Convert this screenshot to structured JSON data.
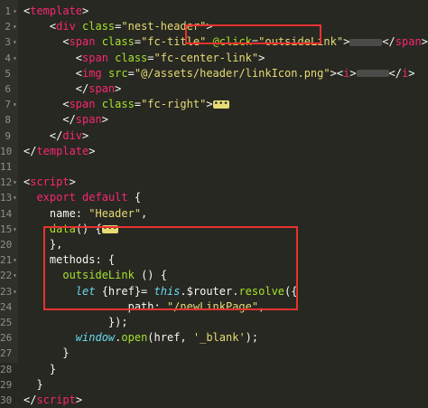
{
  "editor": {
    "lines": [
      {
        "n": "1",
        "segs": [
          {
            "c": "pl",
            "t": "<"
          },
          {
            "c": "tag",
            "t": "template"
          },
          {
            "c": "pl",
            "t": ">"
          }
        ]
      },
      {
        "n": "2",
        "segs": [
          {
            "c": "pl",
            "t": "    <"
          },
          {
            "c": "tag",
            "t": "div"
          },
          {
            "c": "attr",
            "t": " class"
          },
          {
            "c": "pl",
            "t": "="
          },
          {
            "c": "str",
            "t": "\"nest-header\""
          },
          {
            "c": "pl",
            "t": ">"
          }
        ]
      },
      {
        "n": "3",
        "segs": [
          {
            "c": "pl",
            "t": "      <"
          },
          {
            "c": "tag",
            "t": "span"
          },
          {
            "c": "attr",
            "t": " class"
          },
          {
            "c": "pl",
            "t": "="
          },
          {
            "c": "str",
            "t": "\"fc-title\""
          },
          {
            "c": "pl",
            "t": " "
          },
          {
            "c": "attr",
            "t": "@click"
          },
          {
            "c": "pl",
            "t": "="
          },
          {
            "c": "str",
            "t": "\"outsideLink\""
          },
          {
            "c": "pl",
            "t": ">"
          },
          {
            "c": "blur",
            "t": ""
          },
          {
            "c": "pl",
            "t": "</"
          },
          {
            "c": "tag",
            "t": "span"
          },
          {
            "c": "pl",
            "t": ">"
          }
        ]
      },
      {
        "n": "4",
        "segs": [
          {
            "c": "pl",
            "t": "        <"
          },
          {
            "c": "tag",
            "t": "span"
          },
          {
            "c": "attr",
            "t": " class"
          },
          {
            "c": "pl",
            "t": "="
          },
          {
            "c": "str",
            "t": "\"fc-center-link\""
          },
          {
            "c": "pl",
            "t": ">"
          }
        ]
      },
      {
        "n": "5",
        "segs": [
          {
            "c": "pl",
            "t": "        <"
          },
          {
            "c": "tag",
            "t": "img"
          },
          {
            "c": "attr",
            "t": " src"
          },
          {
            "c": "pl",
            "t": "="
          },
          {
            "c": "str",
            "t": "\"@/assets/header/linkIcon.png\""
          },
          {
            "c": "pl",
            "t": ">"
          },
          {
            "c": "pl",
            "t": "<"
          },
          {
            "c": "tag",
            "t": "i"
          },
          {
            "c": "pl",
            "t": ">"
          },
          {
            "c": "blur",
            "t": ""
          },
          {
            "c": "pl",
            "t": "</"
          },
          {
            "c": "tag",
            "t": "i"
          },
          {
            "c": "pl",
            "t": ">"
          }
        ]
      },
      {
        "n": "6",
        "segs": [
          {
            "c": "pl",
            "t": "        </"
          },
          {
            "c": "tag",
            "t": "span"
          },
          {
            "c": "pl",
            "t": ">"
          }
        ]
      },
      {
        "n": "7",
        "segs": [
          {
            "c": "pl",
            "t": "      <"
          },
          {
            "c": "tag",
            "t": "span"
          },
          {
            "c": "attr",
            "t": " class"
          },
          {
            "c": "pl",
            "t": "="
          },
          {
            "c": "str",
            "t": "\"fc-right\""
          },
          {
            "c": "pl",
            "t": ">"
          },
          {
            "c": "ellip",
            "t": "•••"
          }
        ]
      },
      {
        "n": "8",
        "segs": [
          {
            "c": "pl",
            "t": "      </"
          },
          {
            "c": "tag",
            "t": "span"
          },
          {
            "c": "pl",
            "t": ">"
          }
        ]
      },
      {
        "n": "9",
        "segs": [
          {
            "c": "pl",
            "t": "    </"
          },
          {
            "c": "tag",
            "t": "div"
          },
          {
            "c": "pl",
            "t": ">"
          }
        ]
      },
      {
        "n": "10",
        "segs": [
          {
            "c": "pl",
            "t": "</"
          },
          {
            "c": "tag",
            "t": "template"
          },
          {
            "c": "pl",
            "t": ">"
          }
        ]
      },
      {
        "n": "11",
        "segs": []
      },
      {
        "n": "12",
        "segs": [
          {
            "c": "pl",
            "t": "<"
          },
          {
            "c": "tag",
            "t": "script"
          },
          {
            "c": "pl",
            "t": ">"
          }
        ]
      },
      {
        "n": "13",
        "segs": [
          {
            "c": "pl",
            "t": "  "
          },
          {
            "c": "kw",
            "t": "export"
          },
          {
            "c": "pl",
            "t": " "
          },
          {
            "c": "kw",
            "t": "default"
          },
          {
            "c": "pl",
            "t": " {"
          }
        ]
      },
      {
        "n": "14",
        "segs": [
          {
            "c": "pl",
            "t": "    name: "
          },
          {
            "c": "str",
            "t": "\"Header\""
          },
          {
            "c": "pl",
            "t": ","
          }
        ]
      },
      {
        "n": "15",
        "segs": [
          {
            "c": "pl",
            "t": "    "
          },
          {
            "c": "fn",
            "t": "data"
          },
          {
            "c": "pl",
            "t": "() {"
          },
          {
            "c": "ellip",
            "t": "•••"
          }
        ]
      },
      {
        "n": "20",
        "segs": [
          {
            "c": "pl",
            "t": "    },"
          }
        ]
      },
      {
        "n": "21",
        "segs": [
          {
            "c": "pl",
            "t": "    methods: {"
          }
        ]
      },
      {
        "n": "22",
        "segs": [
          {
            "c": "pl",
            "t": "      "
          },
          {
            "c": "fn",
            "t": "outsideLink"
          },
          {
            "c": "pl",
            "t": " () {"
          }
        ]
      },
      {
        "n": "23",
        "segs": [
          {
            "c": "pl",
            "t": "        "
          },
          {
            "c": "kwi",
            "t": "let"
          },
          {
            "c": "pl",
            "t": " {href}= "
          },
          {
            "c": "kwi",
            "t": "this"
          },
          {
            "c": "pl",
            "t": ".$router."
          },
          {
            "c": "fn",
            "t": "resolve"
          },
          {
            "c": "pl",
            "t": "({"
          }
        ]
      },
      {
        "n": "24",
        "segs": [
          {
            "c": "pl",
            "t": "                path: "
          },
          {
            "c": "str",
            "t": "\"/newLinkPage\""
          },
          {
            "c": "pl",
            "t": ","
          }
        ]
      },
      {
        "n": "25",
        "segs": [
          {
            "c": "pl",
            "t": "             });"
          }
        ]
      },
      {
        "n": "26",
        "segs": [
          {
            "c": "pl",
            "t": "        "
          },
          {
            "c": "kwi",
            "t": "window"
          },
          {
            "c": "pl",
            "t": "."
          },
          {
            "c": "fn",
            "t": "open"
          },
          {
            "c": "pl",
            "t": "(href, "
          },
          {
            "c": "str",
            "t": "'_blank'"
          },
          {
            "c": "pl",
            "t": ");"
          }
        ]
      },
      {
        "n": "27",
        "segs": [
          {
            "c": "pl",
            "t": "      }"
          }
        ]
      },
      {
        "n": "28",
        "segs": [
          {
            "c": "pl",
            "t": "    }"
          }
        ]
      },
      {
        "n": "29",
        "segs": [
          {
            "c": "pl",
            "t": "  }"
          }
        ]
      },
      {
        "n": "30",
        "segs": [
          {
            "c": "pl",
            "t": "</"
          },
          {
            "c": "tag",
            "t": "script"
          },
          {
            "c": "pl",
            "t": ">"
          }
        ]
      }
    ],
    "folded_lines": [
      "1",
      "2",
      "3",
      "4",
      "7",
      "12",
      "13",
      "15",
      "21",
      "22",
      "23"
    ],
    "highlight_color": "#e8322e"
  }
}
